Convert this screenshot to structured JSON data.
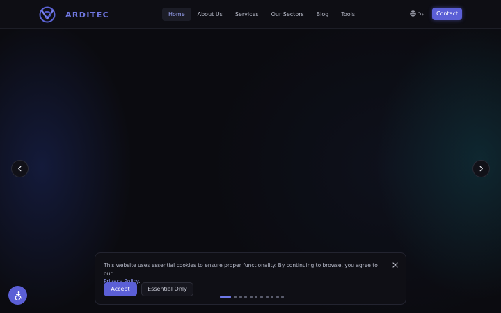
{
  "brand": {
    "name": "ARDITEC",
    "color": "#6f77e0"
  },
  "nav": {
    "items": [
      {
        "label": "Home",
        "active": true
      },
      {
        "label": "About Us",
        "active": false
      },
      {
        "label": "Services",
        "active": false
      },
      {
        "label": "Our Sectors",
        "active": false
      },
      {
        "label": "Blog",
        "active": false
      },
      {
        "label": "Tools",
        "active": false
      }
    ],
    "language": {
      "label": "עב",
      "icon": "globe-icon"
    },
    "contact_label": "Contact"
  },
  "carousel": {
    "prev_icon": "chevron-left-icon",
    "next_icon": "chevron-right-icon",
    "slide_count": 11,
    "active_index": 0
  },
  "cookie_banner": {
    "message": "This website uses essential cookies to ensure proper functionality. By continuing to browse, you agree to our",
    "link_text": "Privacy Policy",
    "link_suffix": ".",
    "accept_label": "Accept",
    "essential_label": "Essential Only",
    "close_icon": "close-icon"
  },
  "accessibility": {
    "icon": "accessibility-icon"
  },
  "colors": {
    "accent": "#5b5fd6",
    "background": "#0b0b10"
  }
}
